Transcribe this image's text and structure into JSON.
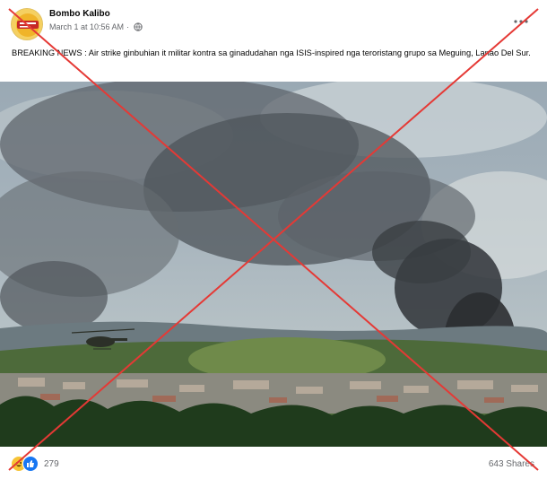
{
  "post": {
    "page_name": "Bombo Kalibo",
    "timestamp": "March 1 at 10:56 AM",
    "separator": "·",
    "privacy_icon": "globe-icon",
    "more_icon": "more-options-icon",
    "caption": "BREAKING NEWS : Air strike ginbuhian  it militar kontra sa  ginadudahan nga  ISIS-inspired nga teroristang grupo sa Meguing, Lanao Del Sur.",
    "photo_description_icon": "news-photo-smoke-over-town"
  },
  "engagement": {
    "reaction_icons": [
      "haha-reaction-icon",
      "like-reaction-icon"
    ],
    "reaction_count": "279",
    "shares": "643 Shares"
  },
  "overlay": {
    "mark": "red-x-mark",
    "color": "#e53935"
  }
}
